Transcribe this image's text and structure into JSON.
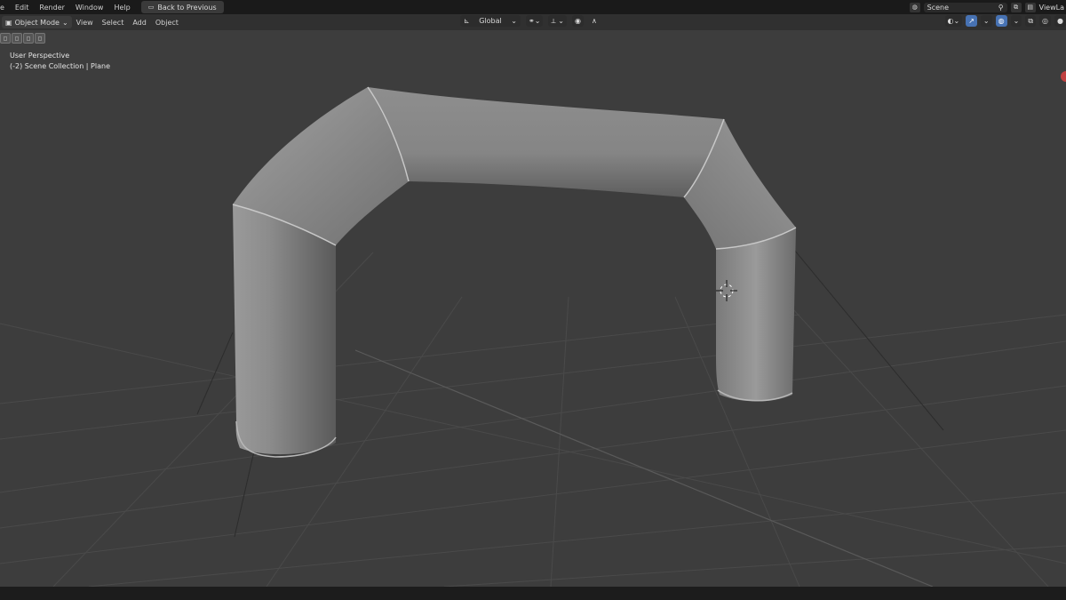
{
  "topbar": {
    "menu": [
      "e",
      "Edit",
      "Render",
      "Window",
      "Help"
    ],
    "back_label": "Back to Previous",
    "scene_name": "Scene",
    "view_layer": "ViewLa"
  },
  "header": {
    "mode": "Object Mode",
    "menus": [
      "View",
      "Select",
      "Add",
      "Object"
    ],
    "orientation": "Global"
  },
  "viewport": {
    "perspective_label": "User Perspective",
    "collection_label": "(-2) Scene Collection | Plane"
  },
  "colors": {
    "viewport_bg": "#3d3d3d",
    "header_bg": "#303030",
    "topbar_bg": "#1a1a1a",
    "object_gray": "#8a8a8a",
    "accent_blue": "#4772b3"
  }
}
